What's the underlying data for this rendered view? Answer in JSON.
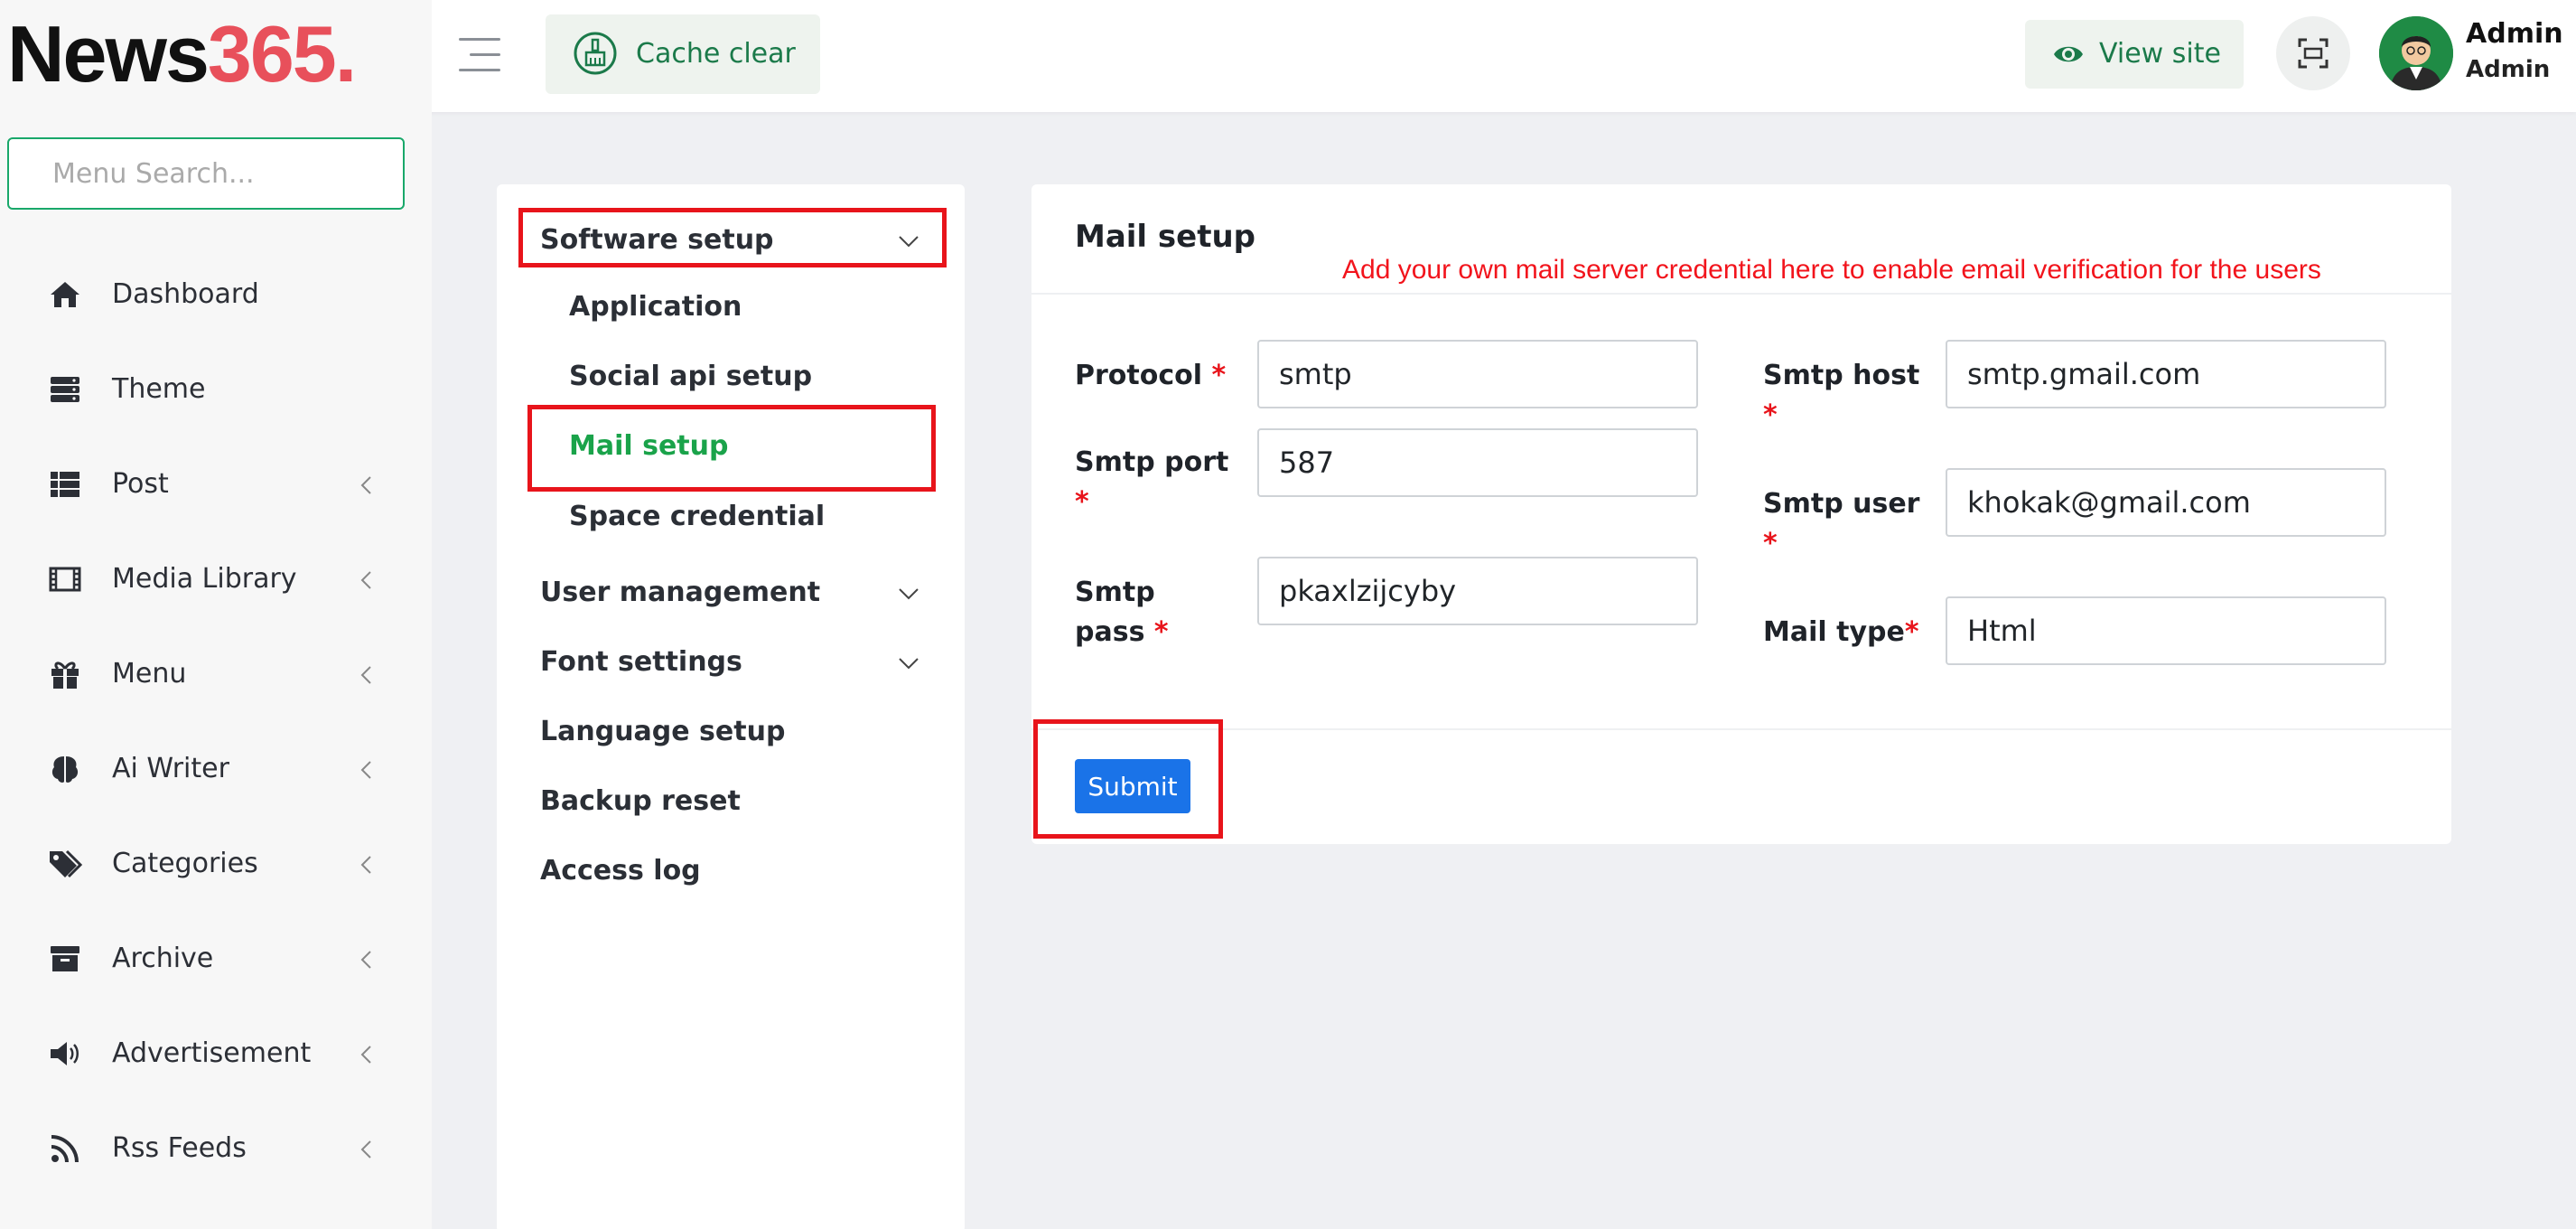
{
  "header": {
    "logo_part1": "News",
    "logo_part2": "365.",
    "cache_clear_label": "Cache clear",
    "view_site_label": "View site",
    "user_name": "Admin",
    "user_role": "Admin"
  },
  "sidebar": {
    "search_placeholder": "Menu Search...",
    "items": [
      {
        "label": "Dashboard",
        "icon": "home-icon"
      },
      {
        "label": "Theme",
        "icon": "server-icon"
      },
      {
        "label": "Post",
        "icon": "list-icon"
      },
      {
        "label": "Media Library",
        "icon": "film-icon"
      },
      {
        "label": "Menu",
        "icon": "gift-icon"
      },
      {
        "label": "Ai Writer",
        "icon": "brain-icon"
      },
      {
        "label": "Categories",
        "icon": "tags-icon"
      },
      {
        "label": "Archive",
        "icon": "archive-icon"
      },
      {
        "label": "Advertisement",
        "icon": "megaphone-icon"
      },
      {
        "label": "Rss Feeds",
        "icon": "rss-icon"
      }
    ]
  },
  "settings_nav": {
    "software_setup": "Software setup",
    "sub_items": [
      "Application",
      "Social api setup",
      "Mail setup",
      "Space credential"
    ],
    "active": "Mail setup",
    "user_management": "User management",
    "font_settings": "Font settings",
    "language_setup": "Language setup",
    "backup_reset": "Backup reset",
    "access_log": "Access log"
  },
  "mail_setup": {
    "title": "Mail setup",
    "note": "Add your own mail server credential here to enable email verification for the users",
    "protocol_label": "Protocol",
    "protocol_value": "smtp",
    "smtp_port_label": "Smtp port",
    "smtp_port_value": "587",
    "smtp_pass_label_1": "Smtp",
    "smtp_pass_label_2": "pass",
    "smtp_pass_value": "pkaxlzijcyby",
    "smtp_host_label": "Smtp host",
    "smtp_host_value": "smtp.gmail.com",
    "smtp_user_label": "Smtp user",
    "smtp_user_value": "khokak@gmail.com",
    "mail_type_label": "Mail type",
    "mail_type_value": "Html",
    "required_mark": "*",
    "submit_label": "Submit"
  },
  "colors": {
    "accent_green": "#1aa34a",
    "highlight_red": "#e8141b",
    "submit_blue": "#1a73e8",
    "logo_red": "#e8505b"
  }
}
